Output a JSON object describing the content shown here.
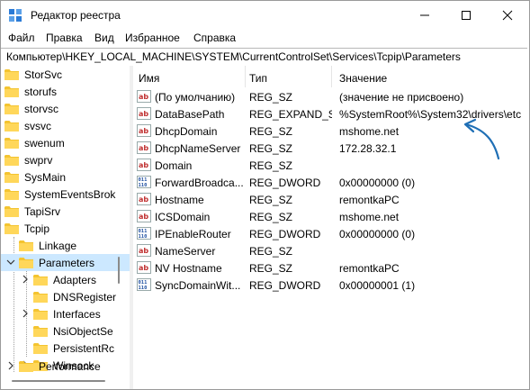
{
  "window": {
    "title": "Редактор реестра"
  },
  "menu": [
    "Файл",
    "Правка",
    "Вид",
    "Избранное",
    "Справка"
  ],
  "address": "Компьютер\\HKEY_LOCAL_MACHINE\\SYSTEM\\CurrentControlSet\\Services\\Tcpip\\Parameters",
  "tree": {
    "items": [
      {
        "label": "StorSvc"
      },
      {
        "label": "storufs"
      },
      {
        "label": "storvsc"
      },
      {
        "label": "svsvc"
      },
      {
        "label": "swenum"
      },
      {
        "label": "swprv"
      },
      {
        "label": "SysMain"
      },
      {
        "label": "SystemEventsBrok"
      },
      {
        "label": "TapiSrv"
      },
      {
        "label": "Tcpip"
      },
      {
        "label": "Linkage"
      },
      {
        "label": "Parameters"
      },
      {
        "label": "Adapters"
      },
      {
        "label": "DNSRegister"
      },
      {
        "label": "Interfaces"
      },
      {
        "label": "NsiObjectSe"
      },
      {
        "label": "PersistentRc"
      },
      {
        "label": "Winsock"
      },
      {
        "label": "Performance"
      }
    ]
  },
  "values": {
    "columns": {
      "name": "Имя",
      "type": "Тип",
      "data": "Значение"
    },
    "rows": [
      {
        "name": "(По умолчанию)",
        "type": "REG_SZ",
        "data": "(значение не присвоено)",
        "icon": "string-value-icon"
      },
      {
        "name": "DataBasePath",
        "type": "REG_EXPAND_SZ",
        "data": "%SystemRoot%\\System32\\drivers\\etc",
        "icon": "string-value-icon"
      },
      {
        "name": "DhcpDomain",
        "type": "REG_SZ",
        "data": "mshome.net",
        "icon": "string-value-icon"
      },
      {
        "name": "DhcpNameServer",
        "type": "REG_SZ",
        "data": "172.28.32.1",
        "icon": "string-value-icon"
      },
      {
        "name": "Domain",
        "type": "REG_SZ",
        "data": "",
        "icon": "string-value-icon"
      },
      {
        "name": "ForwardBroadca...",
        "type": "REG_DWORD",
        "data": "0x00000000 (0)",
        "icon": "binary-value-icon"
      },
      {
        "name": "Hostname",
        "type": "REG_SZ",
        "data": "remontkaPC",
        "icon": "string-value-icon"
      },
      {
        "name": "ICSDomain",
        "type": "REG_SZ",
        "data": "mshome.net",
        "icon": "string-value-icon"
      },
      {
        "name": "IPEnableRouter",
        "type": "REG_DWORD",
        "data": "0x00000000 (0)",
        "icon": "binary-value-icon"
      },
      {
        "name": "NameServer",
        "type": "REG_SZ",
        "data": "",
        "icon": "string-value-icon"
      },
      {
        "name": "NV Hostname",
        "type": "REG_SZ",
        "data": "remontkaPC",
        "icon": "string-value-icon"
      },
      {
        "name": "SyncDomainWit...",
        "type": "REG_DWORD",
        "data": "0x00000001 (1)",
        "icon": "binary-value-icon"
      }
    ]
  },
  "colors": {
    "selection": "#cce8ff",
    "annotation_arrow": "#1f6fb5",
    "folder": "#f4c430"
  }
}
